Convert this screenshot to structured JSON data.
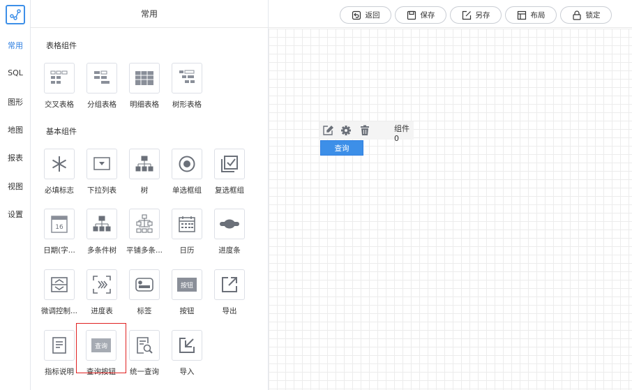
{
  "rail": {
    "logo_icon": "share-nodes-icon",
    "tabs": [
      "常用",
      "SQL",
      "图形",
      "地图",
      "报表",
      "视图",
      "设置"
    ],
    "active_tab": "常用"
  },
  "panel": {
    "title": "常用",
    "sections": [
      {
        "title": "表格组件",
        "items": [
          {
            "label": "交叉表格",
            "icon": "cross-table-icon"
          },
          {
            "label": "分组表格",
            "icon": "group-table-icon"
          },
          {
            "label": "明细表格",
            "icon": "detail-table-icon"
          },
          {
            "label": "树形表格",
            "icon": "tree-table-icon"
          }
        ]
      },
      {
        "title": "基本组件",
        "items": [
          {
            "label": "必填标志",
            "icon": "asterisk-icon"
          },
          {
            "label": "下拉列表",
            "icon": "dropdown-icon"
          },
          {
            "label": "树",
            "icon": "tree-icon"
          },
          {
            "label": "单选框组",
            "icon": "radio-icon"
          },
          {
            "label": "复选框组",
            "icon": "checkbox-icon"
          },
          {
            "label": "日期(字...",
            "icon": "date-icon",
            "icon_text": "16"
          },
          {
            "label": "多条件树",
            "icon": "multi-tree-icon"
          },
          {
            "label": "平铺多条...",
            "icon": "tiled-tree-icon"
          },
          {
            "label": "日历",
            "icon": "calendar-icon"
          },
          {
            "label": "进度条",
            "icon": "progress-bar-icon"
          },
          {
            "label": "微调控制...",
            "icon": "spinner-icon"
          },
          {
            "label": "进度表",
            "icon": "progress-table-icon"
          },
          {
            "label": "标签",
            "icon": "tag-icon"
          },
          {
            "label": "按钮",
            "icon": "button-icon",
            "icon_text": "按钮"
          },
          {
            "label": "导出",
            "icon": "export-icon"
          },
          {
            "label": "指标说明",
            "icon": "doc-icon"
          },
          {
            "label": "查询按钮",
            "icon": "query-button-icon",
            "icon_text": "查询",
            "selected": true
          },
          {
            "label": "统一查询",
            "icon": "unified-query-icon"
          },
          {
            "label": "导入",
            "icon": "import-icon"
          }
        ]
      }
    ]
  },
  "toolbar": {
    "buttons": [
      {
        "label": "返回",
        "icon": "back-icon"
      },
      {
        "label": "保存",
        "icon": "save-icon"
      },
      {
        "label": "另存",
        "icon": "save-as-icon"
      },
      {
        "label": "布局",
        "icon": "layout-icon"
      },
      {
        "label": "锁定",
        "icon": "lock-icon"
      }
    ]
  },
  "canvas": {
    "widget": {
      "name": "组件0",
      "button_label": "查询",
      "tools": [
        "edit-icon",
        "gear-icon",
        "trash-icon"
      ]
    }
  },
  "colors": {
    "accent": "#3d8fe8",
    "selected_outline": "#e02020",
    "icon_gray": "#8a8f99"
  }
}
